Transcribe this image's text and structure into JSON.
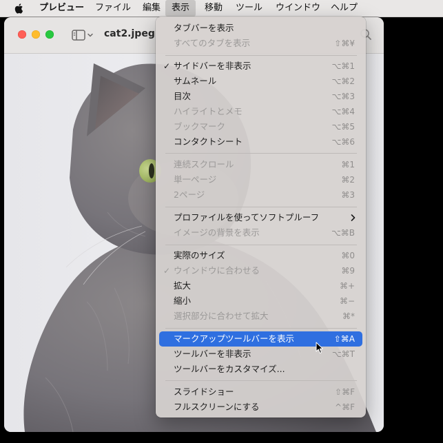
{
  "menubar": {
    "items": [
      "プレビュー",
      "ファイル",
      "編集",
      "表示",
      "移動",
      "ツール",
      "ウインドウ",
      "ヘルプ"
    ]
  },
  "window": {
    "title": "cat2.jpeg"
  },
  "view_menu": {
    "items": [
      {
        "label": "タブバーを表示",
        "shortcut": "",
        "enabled": true,
        "checked": false
      },
      {
        "label": "すべてのタブを表示",
        "shortcut": "⇧⌘¥",
        "enabled": false,
        "checked": false
      },
      {
        "label": "サイドバーを非表示",
        "shortcut": "⌥⌘1",
        "enabled": true,
        "checked": true
      },
      {
        "label": "サムネール",
        "shortcut": "⌥⌘2",
        "enabled": true,
        "checked": false
      },
      {
        "label": "目次",
        "shortcut": "⌥⌘3",
        "enabled": true,
        "checked": false
      },
      {
        "label": "ハイライトとメモ",
        "shortcut": "⌥⌘4",
        "enabled": false,
        "checked": false
      },
      {
        "label": "ブックマーク",
        "shortcut": "⌥⌘5",
        "enabled": false,
        "checked": false
      },
      {
        "label": "コンタクトシート",
        "shortcut": "⌥⌘6",
        "enabled": true,
        "checked": false
      },
      {
        "label": "連続スクロール",
        "shortcut": "⌘1",
        "enabled": false,
        "checked": false
      },
      {
        "label": "単一ページ",
        "shortcut": "⌘2",
        "enabled": false,
        "checked": false
      },
      {
        "label": "2ページ",
        "shortcut": "⌘3",
        "enabled": false,
        "checked": false
      },
      {
        "label": "プロファイルを使ってソフトプルーフ",
        "shortcut": "",
        "enabled": true,
        "checked": false
      },
      {
        "label": "イメージの背景を表示",
        "shortcut": "⌥⌘B",
        "enabled": false,
        "checked": false
      },
      {
        "label": "実際のサイズ",
        "shortcut": "⌘0",
        "enabled": true,
        "checked": false
      },
      {
        "label": "ウインドウに合わせる",
        "shortcut": "⌘9",
        "enabled": false,
        "checked": true
      },
      {
        "label": "拡大",
        "shortcut": "⌘+",
        "enabled": true,
        "checked": false
      },
      {
        "label": "縮小",
        "shortcut": "⌘−",
        "enabled": true,
        "checked": false
      },
      {
        "label": "選択部分に合わせて拡大",
        "shortcut": "⌘*",
        "enabled": false,
        "checked": false
      },
      {
        "label": "マークアップツールバーを表示",
        "shortcut": "⇧⌘A",
        "enabled": true,
        "checked": false
      },
      {
        "label": "ツールバーを非表示",
        "shortcut": "⌥⌘T",
        "enabled": true,
        "checked": false
      },
      {
        "label": "ツールバーをカスタマイズ...",
        "shortcut": "",
        "enabled": true,
        "checked": false
      },
      {
        "label": "スライドショー",
        "shortcut": "⇧⌘F",
        "enabled": true,
        "checked": false
      },
      {
        "label": "フルスクリーンにする",
        "shortcut": "^⌘F",
        "enabled": true,
        "checked": false
      }
    ],
    "check_mark": "✓",
    "highlighted_index": 18
  },
  "colors": {
    "highlight": "#2f6fe0",
    "close": "#ff5f57",
    "minimize": "#febc2e",
    "maximize": "#28c840"
  }
}
